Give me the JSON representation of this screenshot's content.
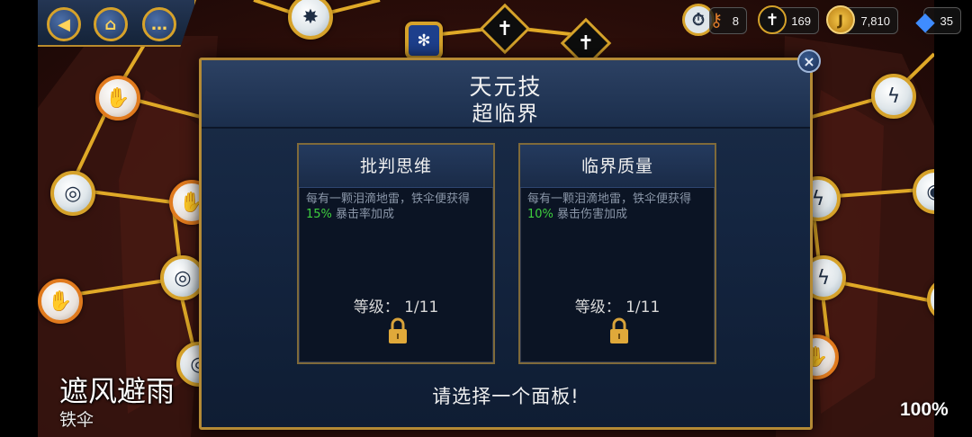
{
  "top_nav": {
    "back_icon": "back-arrow-icon",
    "home_icon": "home-icon",
    "chat_icon": "chat-bubble-icon"
  },
  "currency": {
    "keys": "8",
    "swords": "169",
    "gold": "7,810",
    "gems": "35"
  },
  "modal": {
    "title": "天元技",
    "subtitle": "超临界",
    "cards": [
      {
        "name": "批判思维",
        "desc_prefix": "每有一颗泪滴地雷，铁伞便获得",
        "desc_value": "15%",
        "desc_suffix": "暴击率加成",
        "level_label": "等级：",
        "level_value": "1/11"
      },
      {
        "name": "临界质量",
        "desc_prefix": "每有一颗泪滴地雷，铁伞便获得",
        "desc_value": "10%",
        "desc_suffix": "暴击伤害加成",
        "level_label": "等级：",
        "level_value": "1/11"
      }
    ],
    "prompt": "请选择一个面板!"
  },
  "overlay": {
    "skill_name": "遮风避雨",
    "weapon_name": "铁伞",
    "percent": "100%"
  },
  "colors": {
    "accent_gold": "#d6a22a",
    "highlight_green": "#3ecf3e",
    "modal_bg": "#142540"
  }
}
